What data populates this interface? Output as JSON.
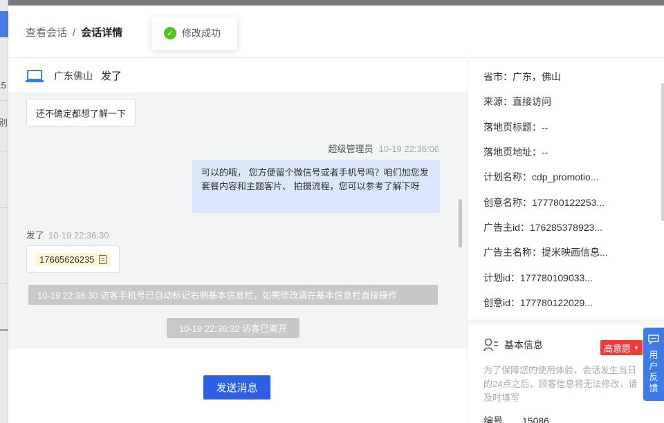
{
  "background": {
    "fragment_1": ":5",
    "fragment_2": "别"
  },
  "breadcrumb": {
    "parent": "查看会话",
    "separator": "/",
    "current": "会话详情"
  },
  "toast": {
    "icon": "check-circle-icon",
    "text": "修改成功",
    "color": "#52c41a"
  },
  "chat": {
    "header": {
      "icon": "laptop-icon",
      "region": "广东佛山",
      "visitor": "发了"
    },
    "messages": {
      "visitor_msg_1": "还不确定都想了解一下",
      "agent_name": "超级管理员",
      "agent_time": "10-19 22:36:06",
      "agent_msg": "可以的哦， 您方便留个微信号或者手机号吗？咱们加您发套餐内容和主题客片、 拍摄流程，您可以参考了解下呀",
      "visitor_name": "发了",
      "visitor_time": "10-19 22:36:30",
      "visitor_phone": "17665626235",
      "system_note_1": "10-19 22:36:30 访客手机号已自动标记右侧基本信息栏，如需修改请在基本信息栏直接操作",
      "system_note_2": "10-19 22:36:32 访客已离开"
    },
    "send_button": "发送消息"
  },
  "info": {
    "rows": [
      "省市：广东，佛山",
      "来源：直接访问",
      "落地页标题：--",
      "落地页地址：--",
      "计划名称：cdp_promotio...",
      "创意名称：177780122253...",
      "广告主id：176285378923...",
      "广告主名称：提米映画信息...",
      "计划id：177780109033...",
      "创意id：177780122029..."
    ],
    "basic": {
      "icon": "user-list-icon",
      "title": "基本信息",
      "intent": "高意愿",
      "note": "为了保障您的使用体验，会话发生当日的24点之后，顾客信息将无法修改，请及时填写",
      "code_label": "编号",
      "code_value": "15086"
    }
  },
  "feedback": {
    "icon": "message-icon",
    "label": "用户反馈"
  },
  "colors": {
    "primary": "#2c5fe3",
    "agent_bubble": "#dbe7fb",
    "badge_red": "#ee3b3b",
    "feedback_blue": "#3d7be8"
  }
}
